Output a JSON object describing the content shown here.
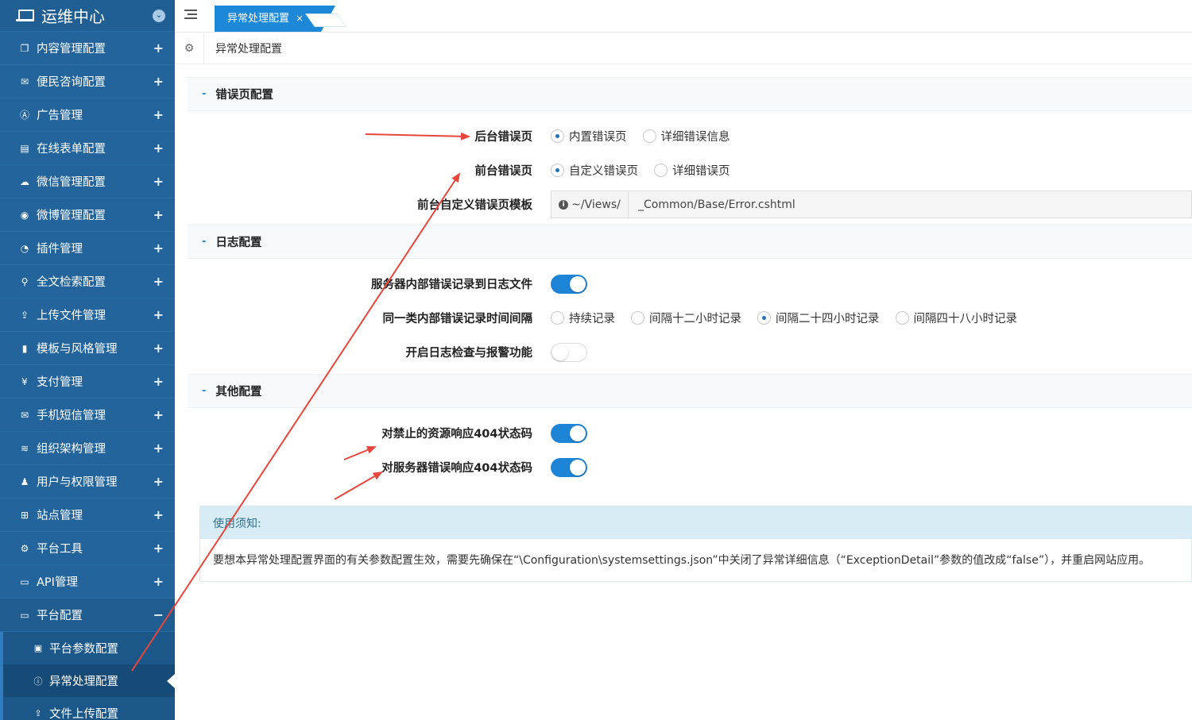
{
  "sidebar": {
    "title": "运维中心",
    "items": [
      {
        "label": "内容管理配置",
        "icon": "copy-icon",
        "glyph": "❐"
      },
      {
        "label": "便民咨询配置",
        "icon": "envelope-icon",
        "glyph": "✉"
      },
      {
        "label": "广告管理",
        "icon": "ad-icon",
        "glyph": "Ⓐ"
      },
      {
        "label": "在线表单配置",
        "icon": "file-icon",
        "glyph": "▤"
      },
      {
        "label": "微信管理配置",
        "icon": "wechat-icon",
        "glyph": "☁"
      },
      {
        "label": "微博管理配置",
        "icon": "weibo-icon",
        "glyph": "◉"
      },
      {
        "label": "插件管理",
        "icon": "pie-chart-icon",
        "glyph": "◔"
      },
      {
        "label": "全文检索配置",
        "icon": "search-icon",
        "glyph": "⚲"
      },
      {
        "label": "上传文件管理",
        "icon": "upload-icon",
        "glyph": "⇪"
      },
      {
        "label": "模板与风格管理",
        "icon": "document-icon",
        "glyph": "▮"
      },
      {
        "label": "支付管理",
        "icon": "yen-icon",
        "glyph": "¥"
      },
      {
        "label": "手机短信管理",
        "icon": "envelope-icon",
        "glyph": "✉"
      },
      {
        "label": "组织架构管理",
        "icon": "layers-icon",
        "glyph": "≋"
      },
      {
        "label": "用户与权限管理",
        "icon": "user-icon",
        "glyph": "♟"
      },
      {
        "label": "站点管理",
        "icon": "site-icon",
        "glyph": "⊞"
      },
      {
        "label": "平台工具",
        "icon": "cogs-icon",
        "glyph": "⚙"
      },
      {
        "label": "API管理",
        "icon": "laptop-icon",
        "glyph": "▭"
      }
    ],
    "open_item": {
      "label": "平台配置",
      "icon": "laptop-icon",
      "glyph": "▭"
    },
    "sub_items": [
      {
        "label": "平台参数配置",
        "icon": "monitor-icon",
        "glyph": "▣"
      },
      {
        "label": "异常处理配置",
        "icon": "exclamation-circle-icon",
        "glyph": "ⓘ"
      },
      {
        "label": "文件上传配置",
        "icon": "upload-icon",
        "glyph": "⇪"
      }
    ],
    "toggle_plus": "+",
    "toggle_minus": "−"
  },
  "tabbar": {
    "active_tab": "异常处理配置",
    "close_glyph": "×"
  },
  "breadcrumb": {
    "text": "异常处理配置"
  },
  "sections": {
    "error_page": {
      "title": "错误页配置",
      "backend_label": "后台错误页",
      "backend_options": [
        "内置错误页",
        "详细错误信息"
      ],
      "backend_selected": 0,
      "frontend_label": "前台错误页",
      "frontend_options": [
        "自定义错误页",
        "详细错误页"
      ],
      "frontend_selected": 0,
      "template_label": "前台自定义错误页模板",
      "template_prefix": "~/Views/",
      "template_value": "_Common/Base/Error.cshtml"
    },
    "log": {
      "title": "日志配置",
      "server_log_label": "服务器内部错误记录到日志文件",
      "server_log_on": true,
      "interval_label": "同一类内部错误记录时间间隔",
      "interval_options": [
        "持续记录",
        "间隔十二小时记录",
        "间隔二十四小时记录",
        "间隔四十八小时记录"
      ],
      "interval_selected": 2,
      "alert_label": "开启日志检查与报警功能",
      "alert_on": false
    },
    "other": {
      "title": "其他配置",
      "forbidden_label": "对禁止的资源响应404状态码",
      "forbidden_on": true,
      "server_error_label": "对服务器错误响应404状态码",
      "server_error_on": true
    }
  },
  "notice": {
    "title": "使用须知:",
    "body": "要想本异常处理配置界面的有关参数配置生效，需要先确保在“\\Configuration\\systemsettings.json”中关闭了异常详细信息（“ExceptionDetail”参数的值改成“false”），并重启网站应用。"
  },
  "colors": {
    "sidebar_bg": "#22649b",
    "accent": "#1e84d6",
    "annotation_red": "#e8453c"
  }
}
